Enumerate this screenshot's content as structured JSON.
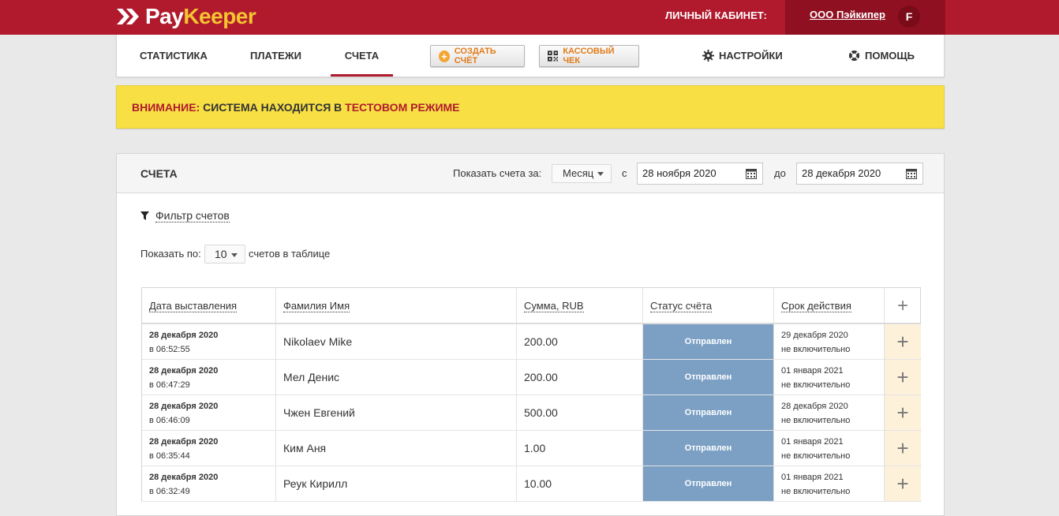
{
  "brand": {
    "pay": "Pay",
    "keeper": "Keeper"
  },
  "header": {
    "cabinet_label": "ЛИЧНЫЙ КАБИНЕТ:",
    "org_name": "ООО Пэйкипер",
    "avatar_letter": "F"
  },
  "nav": {
    "statistics": "СТАТИСТИКА",
    "payments": "ПЛАТЕЖИ",
    "invoices": "СЧЕТА",
    "create_invoice": "СОЗДАТЬ СЧЁТ",
    "cash_receipt": "КАССОВЫЙ ЧЕК",
    "settings": "НАСТРОЙКИ",
    "help": "ПОМОЩЬ"
  },
  "warning": {
    "prefix": "ВНИМАНИЕ:",
    "middle": " СИСТЕМА НАХОДИТСЯ В ",
    "mode": "ТЕСТОВОМ РЕЖИМЕ"
  },
  "panel": {
    "title": "СЧЕТА",
    "show_label": "Показать счета за:",
    "period": "Месяц",
    "from_label": "с",
    "from_date": "28 ноября 2020",
    "to_label": "до",
    "to_date": "28 декабря 2020",
    "filter_label": "Фильтр счетов",
    "perpage_label": "Показать по:",
    "perpage_value": "10",
    "perpage_suffix": "счетов в таблице"
  },
  "table": {
    "columns": [
      "Дата выставления",
      "Фамилия Имя",
      "Сумма, RUB",
      "Статус счёта",
      "Срок действия"
    ],
    "rows": [
      {
        "date": "28 декабря 2020",
        "time": "в 06:52:55",
        "name": "Nikolaev Mike",
        "amount": "200.00",
        "status": "Отправлен",
        "expiry_date": "29 декабря 2020",
        "expiry_note": "не включительно"
      },
      {
        "date": "28 декабря 2020",
        "time": "в 06:47:29",
        "name": "Мел Денис",
        "amount": "200.00",
        "status": "Отправлен",
        "expiry_date": "01 января 2021",
        "expiry_note": "не включительно"
      },
      {
        "date": "28 декабря 2020",
        "time": "в 06:46:09",
        "name": "Чжен Евгений",
        "amount": "500.00",
        "status": "Отправлен",
        "expiry_date": "28 декабря 2020",
        "expiry_note": "не включительно"
      },
      {
        "date": "28 декабря 2020",
        "time": "в 06:35:44",
        "name": "Ким Аня",
        "amount": "1.00",
        "status": "Отправлен",
        "expiry_date": "01 января 2021",
        "expiry_note": "не включительно"
      },
      {
        "date": "28 декабря 2020",
        "time": "в 06:32:49",
        "name": "Реук Кирилл",
        "amount": "10.00",
        "status": "Отправлен",
        "expiry_date": "01 января 2021",
        "expiry_note": "не включительно"
      }
    ]
  },
  "colors": {
    "brand_red": "#b11a2d",
    "brand_yellow": "#f5c531",
    "warning_bg": "#f7df44",
    "status_sent": "#7ba0c4",
    "accent_orange": "#e07b1a"
  },
  "icons": {
    "logo": "double-chevron-logo-icon",
    "create": "plus-circle-icon",
    "receipt": "qr-code-icon",
    "settings": "gear-icon",
    "help": "lifebuoy-icon",
    "filter": "funnel-icon",
    "calendar": "calendar-icon",
    "add": "plus-icon"
  }
}
